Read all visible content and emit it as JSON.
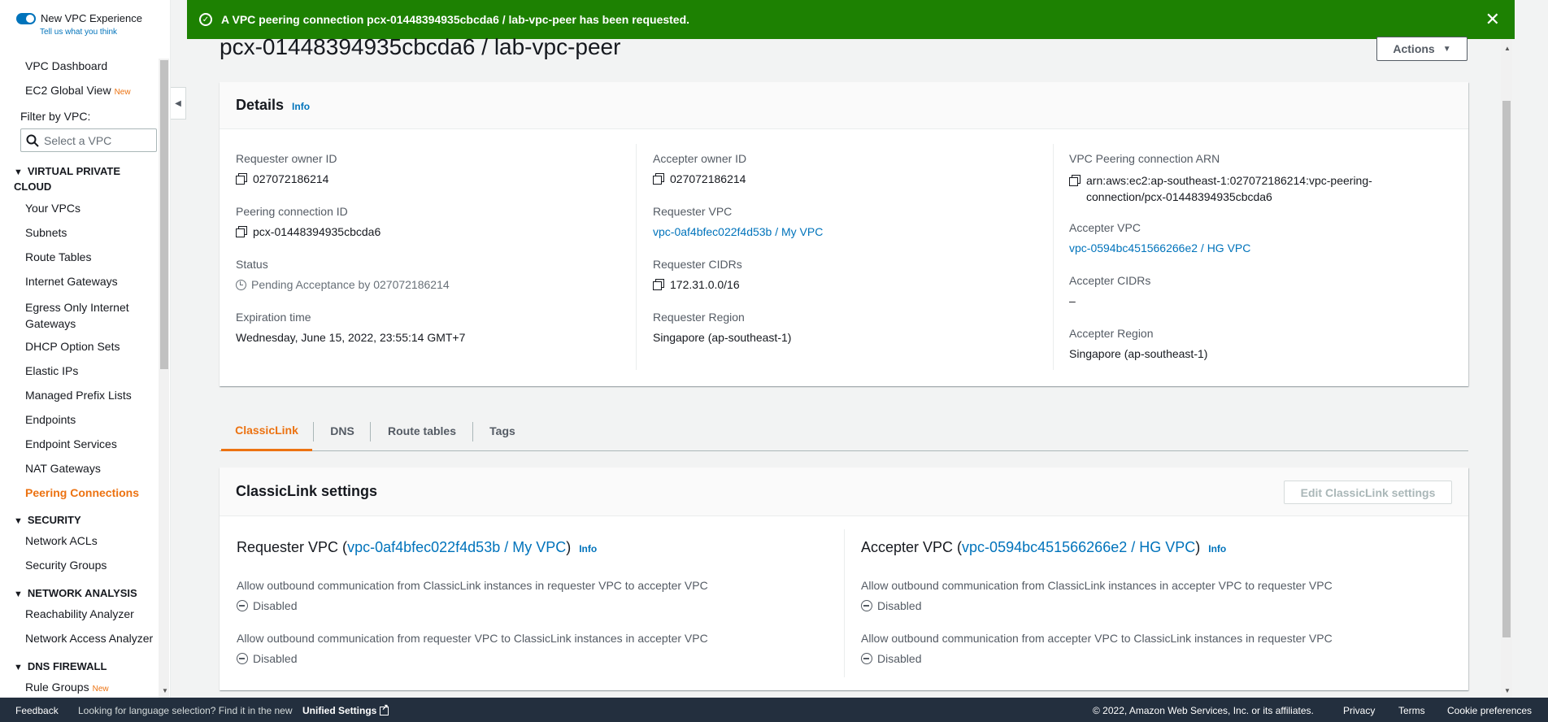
{
  "sidebar": {
    "experience_title": "New VPC Experience",
    "experience_sub": "Tell us what you think",
    "dashboard": "VPC Dashboard",
    "ec2_global": "EC2 Global View",
    "new_tag": "New",
    "filter_label": "Filter by VPC:",
    "filter_placeholder": "Select a VPC",
    "sections": {
      "virtual_private_cloud": "VIRTUAL PRIVATE CLOUD",
      "security": "SECURITY",
      "network_analysis": "NETWORK ANALYSIS",
      "dns_firewall": "DNS FIREWALL"
    },
    "vpc_items": [
      "Your VPCs",
      "Subnets",
      "Route Tables",
      "Internet Gateways",
      "Egress Only Internet Gateways",
      "DHCP Option Sets",
      "Elastic IPs",
      "Managed Prefix Lists",
      "Endpoints",
      "Endpoint Services",
      "NAT Gateways",
      "Peering Connections"
    ],
    "security_items": [
      "Network ACLs",
      "Security Groups"
    ],
    "analysis_items": [
      "Reachability Analyzer",
      "Network Access Analyzer"
    ],
    "dns_items": [
      "Rule Groups"
    ]
  },
  "banner": {
    "message": "A VPC peering connection pcx-01448394935cbcda6 / lab-vpc-peer has been requested.",
    "color": "#1d8102"
  },
  "page": {
    "title": "pcx-01448394935cbcda6 / lab-vpc-peer",
    "actions_label": "Actions"
  },
  "details": {
    "heading": "Details",
    "info": "Info",
    "requester_owner_id_label": "Requester owner ID",
    "requester_owner_id": "027072186214",
    "peering_id_label": "Peering connection ID",
    "peering_id": "pcx-01448394935cbcda6",
    "status_label": "Status",
    "status": "Pending Acceptance by 027072186214",
    "expiration_label": "Expiration time",
    "expiration": "Wednesday, June 15, 2022, 23:55:14 GMT+7",
    "accepter_owner_id_label": "Accepter owner ID",
    "accepter_owner_id": "027072186214",
    "requester_vpc_label": "Requester VPC",
    "requester_vpc": "vpc-0af4bfec022f4d53b / My VPC",
    "requester_cidrs_label": "Requester CIDRs",
    "requester_cidrs": "172.31.0.0/16",
    "requester_region_label": "Requester Region",
    "requester_region": "Singapore (ap-southeast-1)",
    "arn_label": "VPC Peering connection ARN",
    "arn_line1": "arn:aws:ec2:ap-southeast-1:027072186214:vpc-peering-",
    "arn_line2": "connection/pcx-01448394935cbcda6",
    "accepter_vpc_label": "Accepter VPC",
    "accepter_vpc": "vpc-0594bc451566266e2 / HG VPC",
    "accepter_cidrs_label": "Accepter CIDRs",
    "accepter_cidrs": "–",
    "accepter_region_label": "Accepter Region",
    "accepter_region": "Singapore (ap-southeast-1)"
  },
  "tabs": [
    "ClassicLink",
    "DNS",
    "Route tables",
    "Tags"
  ],
  "classiclink": {
    "heading": "ClassicLink settings",
    "edit_label": "Edit ClassicLink settings",
    "requester_prefix": "Requester VPC (",
    "requester_vpc": "vpc-0af4bfec022f4d53b / My VPC",
    "accepter_prefix": "Accepter VPC (",
    "accepter_vpc": "vpc-0594bc451566266e2 / HG VPC",
    "close_paren": ")",
    "info": "Info",
    "req_opt1": "Allow outbound communication from ClassicLink instances in requester VPC to accepter VPC",
    "req_opt2": "Allow outbound communication from requester VPC to ClassicLink instances in accepter VPC",
    "acc_opt1": "Allow outbound communication from ClassicLink instances in accepter VPC to requester VPC",
    "acc_opt2": "Allow outbound communication from accepter VPC to ClassicLink instances in requester VPC",
    "disabled": "Disabled"
  },
  "footer": {
    "feedback": "Feedback",
    "lang_text": "Looking for language selection? Find it in the new",
    "unified": "Unified Settings",
    "copyright": "© 2022, Amazon Web Services, Inc. or its affiliates.",
    "privacy": "Privacy",
    "terms": "Terms",
    "cookies": "Cookie preferences"
  },
  "colors": {
    "accent": "#ec7211",
    "link": "#0073bb",
    "footer_bg": "#232f3e"
  }
}
